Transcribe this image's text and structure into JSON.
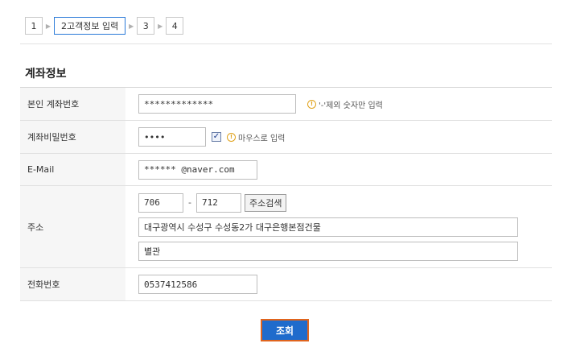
{
  "steps": [
    {
      "label": "1"
    },
    {
      "label": "2고객정보 입력"
    },
    {
      "label": "3"
    },
    {
      "label": "4"
    }
  ],
  "section": {
    "title": "계좌정보"
  },
  "form": {
    "account_number": {
      "label": "본인 계좌번호",
      "value": "*************",
      "hint": "'-'제외 숫자만 입력"
    },
    "account_password": {
      "label": "계좌비밀번호",
      "value": "••••",
      "checked": true,
      "hint": "마우스로 입력"
    },
    "email": {
      "label": "E-Mail",
      "value": "****** @naver.com"
    },
    "address": {
      "label": "주소",
      "zip1": "706",
      "zip_separator": "-",
      "zip2": "712",
      "search_button": "주소검색",
      "line1": "대구광역시 수성구 수성동2가 대구은행본점건물",
      "line2": "별관"
    },
    "phone": {
      "label": "전화번호",
      "value": "0537412586"
    }
  },
  "submit": {
    "label": "조회"
  },
  "colors": {
    "accent": "#1f6bcc",
    "highlight_border": "#e0641d",
    "active_step_border": "#2a7ad8"
  }
}
